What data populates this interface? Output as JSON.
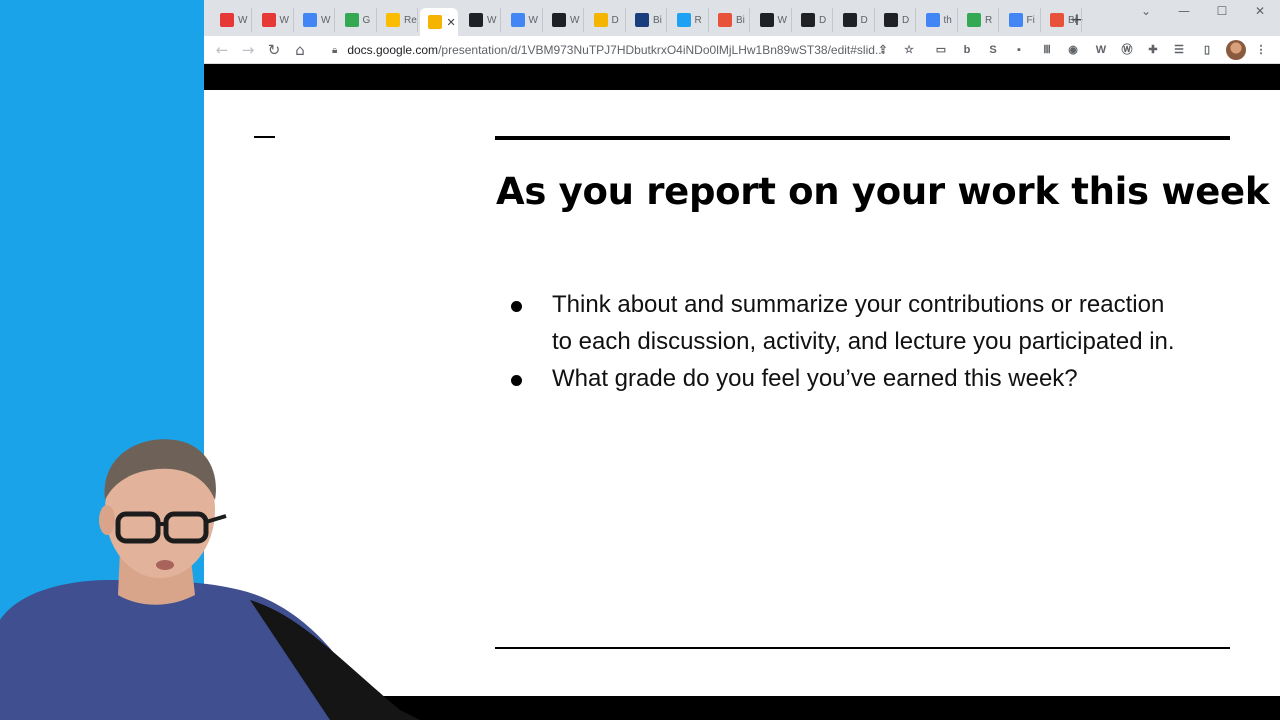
{
  "browser": {
    "tabs": [
      {
        "icon": "opera-icon",
        "label": "W",
        "color": "#e53935"
      },
      {
        "icon": "opera-icon",
        "label": "W",
        "color": "#e53935"
      },
      {
        "icon": "google-docs-icon",
        "label": "W",
        "color": "#4285f4"
      },
      {
        "icon": "google-calendar-icon",
        "label": "G",
        "color": "#34a853"
      },
      {
        "icon": "google-drive-icon",
        "label": "Re",
        "color": "#fbbc04"
      },
      {
        "icon": "google-slides-icon",
        "label": "",
        "color": "#f4b400",
        "active": true
      },
      {
        "icon": "wikipedia-icon",
        "label": "W",
        "color": "#202124"
      },
      {
        "icon": "google-docs-icon",
        "label": "W",
        "color": "#4285f4"
      },
      {
        "icon": "cloud-icon",
        "label": "W",
        "color": "#202124"
      },
      {
        "icon": "hand-icon",
        "label": "D",
        "color": "#f4b400"
      },
      {
        "icon": "library-icon",
        "label": "Bi",
        "color": "#1a3d7c"
      },
      {
        "icon": "twitter-icon",
        "label": "R",
        "color": "#1da1f2"
      },
      {
        "icon": "b-icon",
        "label": "Bi",
        "color": "#e8523a"
      },
      {
        "icon": "wikipedia-icon",
        "label": "W",
        "color": "#202124"
      },
      {
        "icon": "dict-icon",
        "label": "D",
        "color": "#202124"
      },
      {
        "icon": "dict-icon",
        "label": "D",
        "color": "#202124"
      },
      {
        "icon": "dict-icon",
        "label": "D",
        "color": "#202124"
      },
      {
        "icon": "google-docs-icon",
        "label": "th",
        "color": "#4285f4"
      },
      {
        "icon": "google-drive-icon",
        "label": "R",
        "color": "#34a853"
      },
      {
        "icon": "google-docs-icon",
        "label": "Fi",
        "color": "#4285f4"
      },
      {
        "icon": "b-icon",
        "label": "Bi",
        "color": "#e8523a"
      }
    ],
    "active_tab_close": "✕",
    "new_tab": "+",
    "url_host": "docs.google.com",
    "url_path": "/presentation/d/1VBM973NuTPJ7HDbutkrxO4iNDo0lMjLHw1Bn89wST38/edit#slid..."
  },
  "slide": {
    "title": "As you report on your work this week",
    "bullets": [
      "Think about and summarize your contributions or reaction to each discussion, activity, and lecture you participated in.",
      "What grade do you feel you’ve earned this week?"
    ]
  },
  "colors": {
    "webcam_background": "#1aa3e8",
    "tabstrip": "#dee1e6",
    "presenter_bar": "#000000"
  }
}
